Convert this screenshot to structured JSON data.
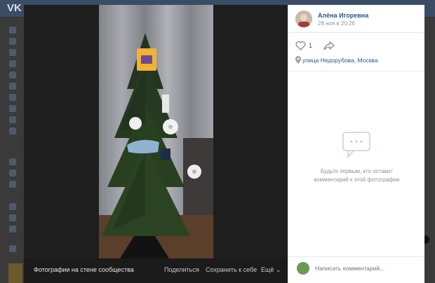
{
  "background": {
    "logo": "VK"
  },
  "viewer": {
    "source_label": "Фотографии на стене сообщества",
    "actions": {
      "share": "Поделиться",
      "save": "Сохранить к себе",
      "more": "Ещё"
    },
    "photo_icon": "christmas-tree-photo"
  },
  "panel": {
    "author": "Алёна Игоревна",
    "date": "28 ноя в 20:26",
    "likes": "1",
    "location": "улица Недорубова, Москва",
    "empty_comments": "Будьте первым, кто оставит\nкомментарий к этой фотографии",
    "comment_placeholder": "Написать комментарий..."
  },
  "colors": {
    "accent": "#2a5885",
    "muted": "#939393",
    "viewer_bg": "#1e1e1e"
  }
}
